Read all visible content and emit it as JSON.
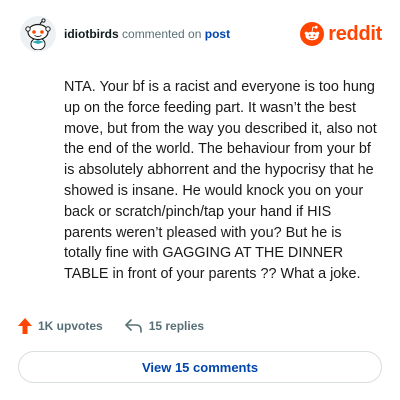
{
  "header": {
    "username": "idiotbirds",
    "commented_text": "commented on",
    "post_link": "post",
    "brand_name": "reddit"
  },
  "comment": {
    "body": "NTA. Your bf is a racist and everyone is too hung up on the force feeding part. It wasn’t the best move, but from the way you described it, also not the end of the world. The behaviour from your bf is absolutely abhorrent and the hypocrisy that he showed is insane. He would knock you on your back or scratch/pinch/tap your hand if HIS parents weren’t pleased with you? But he is totally fine with GAGGING AT THE DINNER TABLE in front of your parents ?? What a joke."
  },
  "actions": {
    "upvotes": "1K upvotes",
    "replies": "15 replies"
  },
  "view_comments_label": "View 15 comments",
  "colors": {
    "brand": "#ff4500",
    "link": "#0045ac",
    "muted": "#576f76"
  },
  "icons": {
    "avatar": "snoo-avatar-icon",
    "logo": "reddit-logo-icon",
    "upvote": "upvote-arrow-icon",
    "reply": "reply-arrow-icon"
  }
}
